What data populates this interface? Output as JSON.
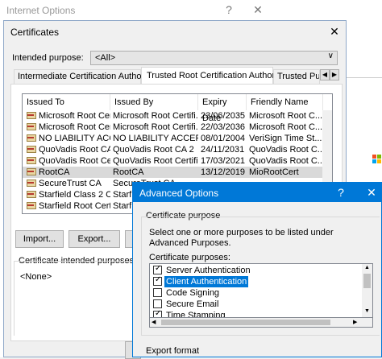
{
  "internet_options": {
    "title": "Internet Options",
    "help": "?",
    "close": "✕"
  },
  "certificates": {
    "title": "Certificates",
    "close": "✕",
    "intended_purpose_label": "Intended purpose:",
    "intended_purpose_value": "<All>",
    "tabs": [
      "Intermediate Certification Authorities",
      "Trusted Root Certification Authorities",
      "Trusted Publ"
    ],
    "columns": [
      "Issued To",
      "Issued By",
      "Expiry Date",
      "Friendly Name"
    ],
    "rows": [
      [
        "Microsoft Root Certi...",
        "Microsoft Root Certifi...",
        "23/06/2035",
        "Microsoft Root C..."
      ],
      [
        "Microsoft Root Certi...",
        "Microsoft Root Certifi...",
        "22/03/2036",
        "Microsoft Root C..."
      ],
      [
        "NO LIABILITY ACCEP...",
        "NO LIABILITY ACCEP...",
        "08/01/2004",
        "VeriSign Time St..."
      ],
      [
        "QuoVadis Root CA 2",
        "QuoVadis Root CA 2",
        "24/11/2031",
        "QuoVadis Root C..."
      ],
      [
        "QuoVadis Root Certi...",
        "QuoVadis Root Certifi...",
        "17/03/2021",
        "QuoVadis Root C..."
      ],
      [
        "RootCA",
        "RootCA",
        "13/12/2019",
        "MioRootCert"
      ],
      [
        "SecureTrust CA",
        "SecureTrust CA",
        "",
        ""
      ],
      [
        "Starfield Class 2 Ce...",
        "Starfie",
        "",
        ""
      ],
      [
        "Starfield Root Certi...",
        "Starfie",
        "",
        ""
      ]
    ],
    "buttons": {
      "import": "Import...",
      "export": "Export..."
    },
    "intended_purposes_label": "Certificate intended purposes",
    "intended_purposes_value": "<None>"
  },
  "advanced": {
    "title": "Advanced Options",
    "help": "?",
    "close": "✕",
    "group_label": "Certificate purpose",
    "description": "Select one or more purposes to be listed under Advanced Purposes.",
    "list_label": "Certificate purposes:",
    "purposes": [
      {
        "label": "Server Authentication",
        "checked": true
      },
      {
        "label": "Client Authentication",
        "checked": true
      },
      {
        "label": "Code Signing",
        "checked": false
      },
      {
        "label": "Secure Email",
        "checked": false
      },
      {
        "label": "Time Stamping",
        "checked": true
      }
    ],
    "export_format": "Export format"
  },
  "colors": {
    "accent": "#0078d7",
    "selection": "#cce8ff"
  }
}
